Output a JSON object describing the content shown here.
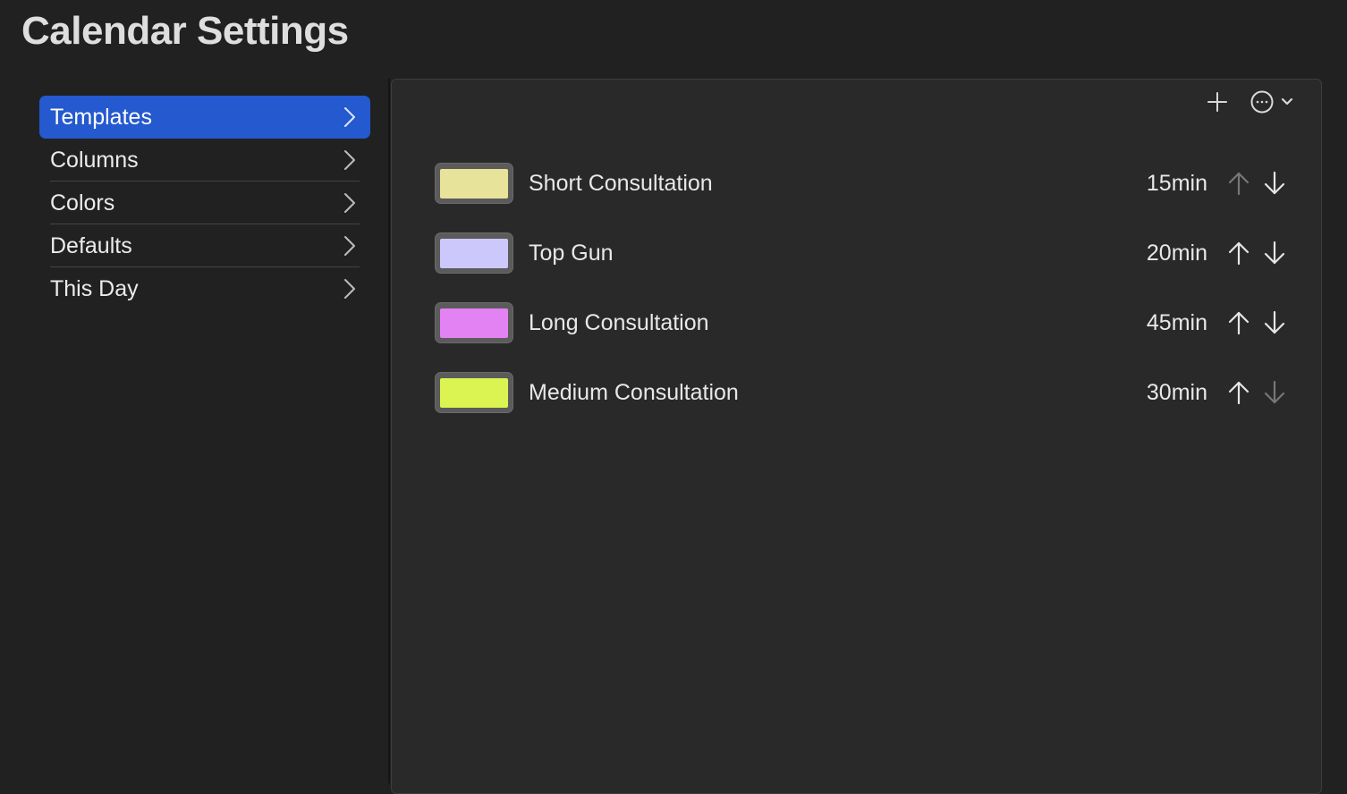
{
  "page": {
    "title": "Calendar Settings"
  },
  "sidebar": {
    "items": [
      {
        "label": "Templates",
        "selected": true
      },
      {
        "label": "Columns",
        "selected": false
      },
      {
        "label": "Colors",
        "selected": false
      },
      {
        "label": "Defaults",
        "selected": false
      },
      {
        "label": "This Day",
        "selected": false
      }
    ]
  },
  "toolbar": {
    "add_icon": "plus-icon",
    "more_icon": "ellipsis-circle-icon",
    "more_dropdown_icon": "chevron-down-icon"
  },
  "templates": [
    {
      "name": "Short Consultation",
      "duration": "15min",
      "color": "#e8e39a",
      "up_enabled": false,
      "down_enabled": true
    },
    {
      "name": "Top Gun",
      "duration": "20min",
      "color": "#cdc8fb",
      "up_enabled": true,
      "down_enabled": true
    },
    {
      "name": "Long Consultation",
      "duration": "45min",
      "color": "#e382f2",
      "up_enabled": true,
      "down_enabled": true
    },
    {
      "name": "Medium Consultation",
      "duration": "30min",
      "color": "#dcf452",
      "up_enabled": true,
      "down_enabled": false
    }
  ],
  "colors": {
    "accent": "#2459cf",
    "background": "#212121",
    "panel": "#292929"
  }
}
